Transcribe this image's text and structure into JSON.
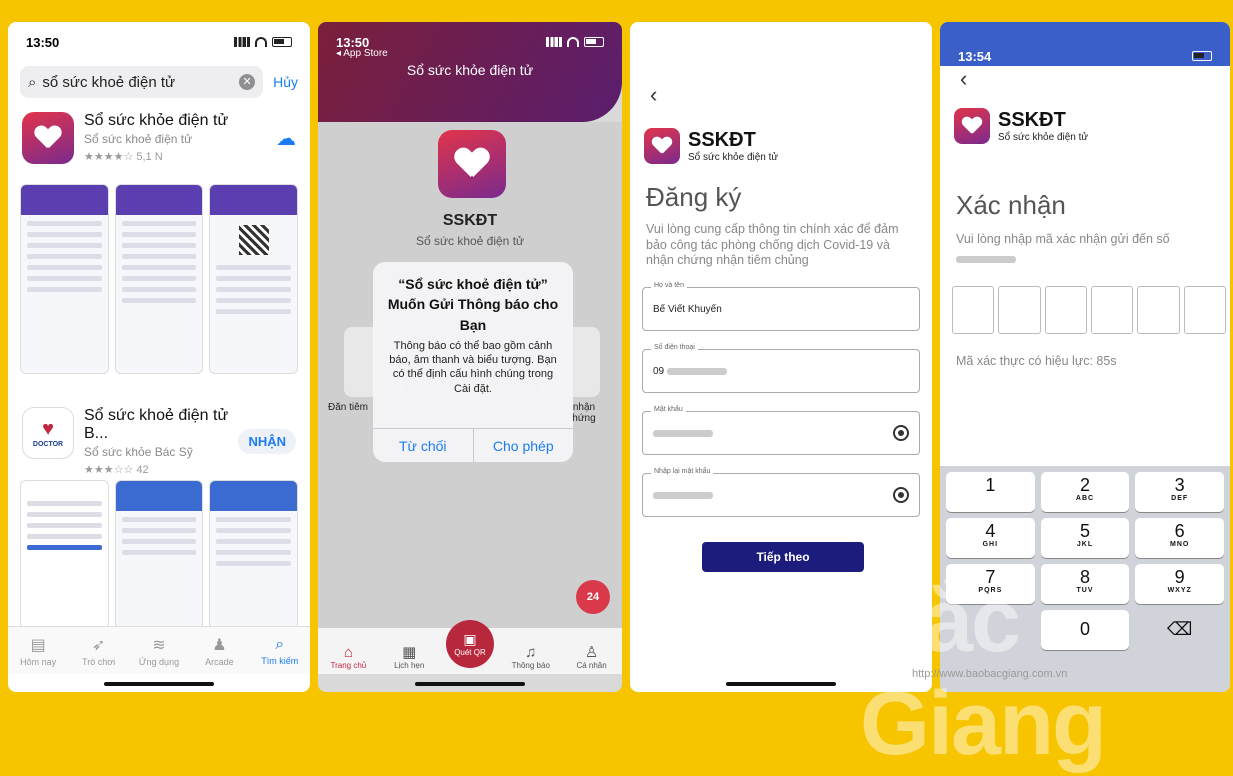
{
  "phone1": {
    "time": "13:50",
    "search_value": "sổ sức khoẻ điện tử",
    "cancel": "Hủy",
    "app1": {
      "name": "Sổ sức khỏe điện tử",
      "sub": "Sổ sức khoẻ điện tử",
      "rating": "★★★★☆ 5,1 N"
    },
    "app2": {
      "name": "Sổ sức khoẻ điện tử B...",
      "sub": "Sổ sức khỏe Bác Sỹ",
      "rating": "★★★☆☆ 42",
      "get": "NHẬN",
      "badge": "DOCTOR"
    },
    "tabs": [
      "Hôm nay",
      "Trò chơi",
      "Ứng dụng",
      "Arcade",
      "Tìm kiếm"
    ]
  },
  "phone2": {
    "time": "13:50",
    "back": "◂ App Store",
    "title": "Sổ sức khỏe điện tử",
    "app_name": "SSKĐT",
    "app_sub": "Sổ sức khoẻ điện tử",
    "dialog_title": "“Sổ sức khoẻ điện tử” Muốn Gửi Thông báo cho Bạn",
    "dialog_msg": "Thông báo có thể bao gồm cảnh báo, âm thanh và biểu tượng. Bạn có thể định cấu hình chúng trong Cài đặt.",
    "deny": "Từ chối",
    "allow": "Cho phép",
    "card_left": "Đăn tiêm",
    "card_right": "nhận hứng",
    "fab": "24",
    "tabs": [
      "Trang chủ",
      "Lịch hẹn",
      "Quét QR",
      "Thông báo",
      "Cá nhân"
    ]
  },
  "phone3": {
    "brand": "SSKĐT",
    "brand_sub": "Sổ sức khỏe điện tử",
    "heading": "Đăng ký",
    "desc": "Vui lòng cung cấp thông tin chính xác để đảm bảo công tác phòng chống dịch Covid-19 và nhận chứng nhận tiêm chủng",
    "fields": [
      {
        "label": "Họ và tên",
        "value": "Bế Viết Khuyến"
      },
      {
        "label": "Số điện thoại",
        "value": "09"
      },
      {
        "label": "Mật khẩu",
        "value": ""
      },
      {
        "label": "Nhập lại mật khẩu",
        "value": ""
      }
    ],
    "next": "Tiếp theo"
  },
  "phone4": {
    "time": "13:54",
    "brand": "SSKĐT",
    "brand_sub": "Sổ sức khỏe điện tử",
    "heading": "Xác nhận",
    "desc": "Vui lòng nhập mã xác nhận gửi đến số",
    "validity": "Mã xác thực có hiệu lực: 85s",
    "keys": [
      [
        "1",
        ""
      ],
      [
        "2",
        "ABC"
      ],
      [
        "3",
        "DEF"
      ],
      [
        "4",
        "GHI"
      ],
      [
        "5",
        "JKL"
      ],
      [
        "6",
        "MNO"
      ],
      [
        "7",
        "PQRS"
      ],
      [
        "8",
        "TUV"
      ],
      [
        "9",
        "WXYZ"
      ],
      [
        "0",
        ""
      ]
    ],
    "watermark": "Bắc Giang",
    "url": "http://www.baobacgiang.com.vn"
  }
}
